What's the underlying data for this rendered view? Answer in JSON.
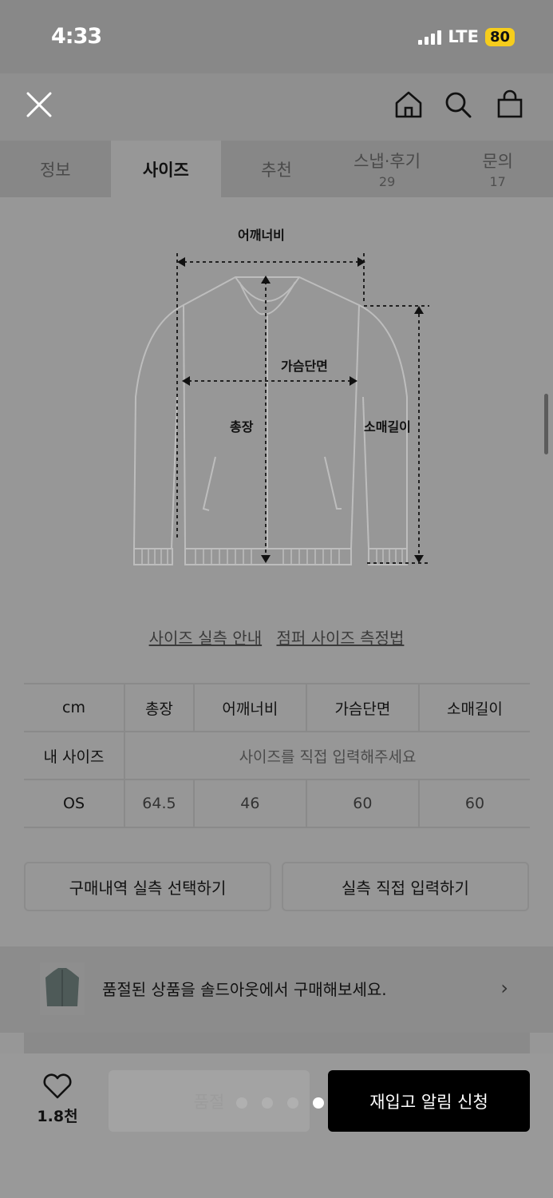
{
  "status": {
    "time": "4:33",
    "network": "LTE",
    "battery": "80"
  },
  "header": {
    "close_icon": "close-icon",
    "home_icon": "home-icon",
    "search_icon": "search-icon",
    "bag_icon": "bag-icon"
  },
  "tabs": [
    {
      "label": "정보",
      "count": ""
    },
    {
      "label": "사이즈",
      "count": ""
    },
    {
      "label": "추천",
      "count": ""
    },
    {
      "label": "스냅·후기",
      "count": "29"
    },
    {
      "label": "문의",
      "count": "17"
    }
  ],
  "diagram": {
    "shoulder": "어깨너비",
    "chest": "가슴단면",
    "length": "총장",
    "sleeve": "소매길이"
  },
  "links": {
    "guide": "사이즈 실측 안내",
    "method": "점퍼 사이즈 측정법"
  },
  "size_table": {
    "headers": [
      "cm",
      "총장",
      "어깨너비",
      "가슴단면",
      "소매길이"
    ],
    "my_size_label": "내 사이즈",
    "my_size_placeholder": "사이즈를 직접 입력해주세요",
    "rows": [
      {
        "label": "OS",
        "values": [
          "64.5",
          "46",
          "60",
          "60"
        ]
      }
    ]
  },
  "buttons": {
    "purchase_history": "구매내역 실측 선택하기",
    "direct_input": "실측 직접 입력하기"
  },
  "banner": {
    "text": "품절된 상품을 솔드아웃에서 구매해보세요."
  },
  "bottom": {
    "like_count": "1.8천",
    "soldout_label": "품절",
    "restock_label": "재입고 알림 신청"
  },
  "colors": {
    "restock_bg": "#000000",
    "battery": "#f6cd1c"
  }
}
